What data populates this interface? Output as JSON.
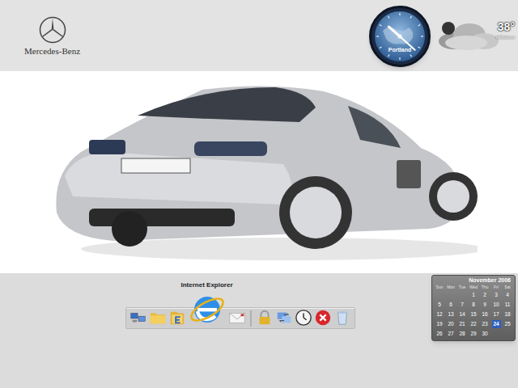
{
  "wallpaper": {
    "brand": "Mercedes-Benz"
  },
  "clock_gadget": {
    "city": "Portland",
    "hour": 10,
    "minute": 22
  },
  "weather_gadget": {
    "temperature": "38°",
    "city": "Hillsboro"
  },
  "dock": {
    "tooltip": "Internet Explorer",
    "items": [
      {
        "kind": "network",
        "magnified": false
      },
      {
        "kind": "folder",
        "magnified": false
      },
      {
        "kind": "explorer",
        "magnified": false
      },
      {
        "kind": "browser",
        "magnified": true
      },
      {
        "kind": "mail",
        "magnified": false
      },
      {
        "kind": "separator",
        "magnified": false
      },
      {
        "kind": "lock",
        "magnified": false
      },
      {
        "kind": "transfer",
        "magnified": false
      },
      {
        "kind": "clock",
        "magnified": false
      },
      {
        "kind": "close",
        "magnified": false
      },
      {
        "kind": "trash",
        "magnified": false
      }
    ]
  },
  "calendar": {
    "title": "November 2006",
    "weekdays": [
      "Sun",
      "Mon",
      "Tue",
      "Wed",
      "Thu",
      "Fri",
      "Sat"
    ],
    "weeks": [
      [
        "",
        "",
        "",
        "1",
        "2",
        "3",
        "4"
      ],
      [
        "5",
        "6",
        "7",
        "8",
        "9",
        "10",
        "11"
      ],
      [
        "12",
        "13",
        "14",
        "15",
        "16",
        "17",
        "18"
      ],
      [
        "19",
        "20",
        "21",
        "22",
        "23",
        "24",
        "25"
      ],
      [
        "26",
        "27",
        "28",
        "29",
        "30",
        "",
        ""
      ]
    ],
    "selected_day": "24"
  }
}
